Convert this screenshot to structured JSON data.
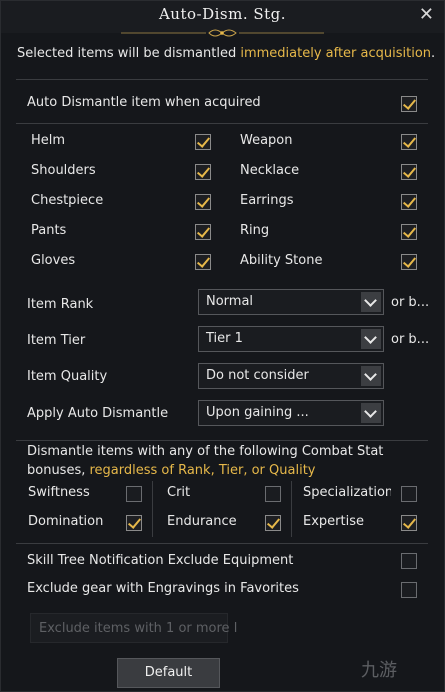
{
  "window": {
    "title": "Auto-Dism. Stg."
  },
  "subtitle": {
    "text_before": "Selected items will be dismantled ",
    "highlight": "immediately after acquisition",
    "text_after": "."
  },
  "auto_dismantle": {
    "label": "Auto Dismantle item when acquired",
    "checked": true
  },
  "slots": [
    {
      "label": "Helm",
      "checked": true
    },
    {
      "label": "Weapon",
      "checked": true
    },
    {
      "label": "Shoulders",
      "checked": true
    },
    {
      "label": "Necklace",
      "checked": true
    },
    {
      "label": "Chestpiece",
      "checked": true
    },
    {
      "label": "Earrings",
      "checked": true
    },
    {
      "label": "Pants",
      "checked": true
    },
    {
      "label": "Ring",
      "checked": true
    },
    {
      "label": "Gloves",
      "checked": true
    },
    {
      "label": "Ability Stone",
      "checked": true
    }
  ],
  "filters": [
    {
      "label": "Item Rank",
      "value": "Normal",
      "suffix": "or b..."
    },
    {
      "label": "Item Tier",
      "value": "Tier 1",
      "suffix": "or b..."
    },
    {
      "label": "Item Quality",
      "value": "Do not consider",
      "suffix": ""
    },
    {
      "label": "Apply Auto Dismantle",
      "value": "Upon gaining ...",
      "suffix": ""
    }
  ],
  "combat": {
    "text_line1": "Dismantle items with any of the following Combat Stat",
    "text_line2_before": "bonuses, ",
    "text_line2_highlight": "regardless of Rank, Tier, or Quality",
    "stats": [
      {
        "label": "Swiftness",
        "checked": false
      },
      {
        "label": "Crit",
        "checked": false
      },
      {
        "label": "Specialization",
        "checked": false
      },
      {
        "label": "Domination",
        "checked": true
      },
      {
        "label": "Endurance",
        "checked": true
      },
      {
        "label": "Expertise",
        "checked": true
      }
    ]
  },
  "options": [
    {
      "label": "Skill Tree Notification Exclude Equipment",
      "checked": false
    },
    {
      "label": "Exclude gear with Engravings in Favorites",
      "checked": false
    }
  ],
  "exclude_input": {
    "placeholder": "Exclude items with 1 or more l"
  },
  "default_button": {
    "label": "Default"
  },
  "watermark": {
    "text": "九游"
  },
  "colors": {
    "accent": "#e6b84a",
    "background": "#15171b",
    "border": "#3a3c40"
  }
}
